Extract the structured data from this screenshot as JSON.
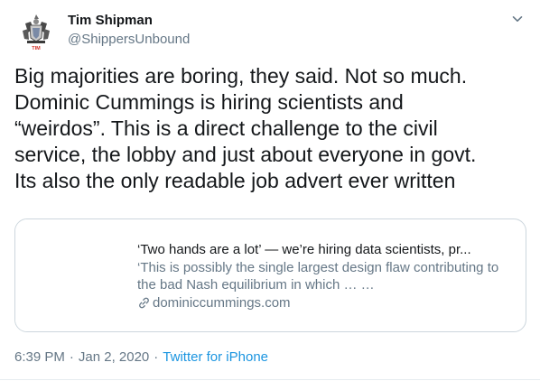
{
  "author": {
    "name": "Tim Shipman",
    "handle": "@ShippersUnbound",
    "avatar_icon": "crest-avatar-icon",
    "avatar_text": "TIM"
  },
  "menu": {
    "icon": "chevron-down-icon"
  },
  "tweet": {
    "text": "Big majorities are boring, they said. Not so much.\nDominic Cummings is hiring scientists and\n“weirdos”. This is a direct challenge to the civil\nservice, the lobby and just about everyone in govt.\nIts also the only readable job advert ever written"
  },
  "card": {
    "title": "‘Two hands are a lot’ — we’re hiring data scientists, pr...",
    "description": "‘This is possibly the single largest design flaw contributing to the bad Nash equilibrium in which … …",
    "domain": "dominiccummings.com",
    "domain_icon": "link-icon"
  },
  "meta": {
    "time": "6:39 PM",
    "separator": "·",
    "date": "Jan 2, 2020",
    "source": "Twitter for iPhone"
  },
  "colors": {
    "text": "#14171a",
    "secondary": "#657786",
    "link": "#1b95e0",
    "border": "#ccd6dd"
  }
}
